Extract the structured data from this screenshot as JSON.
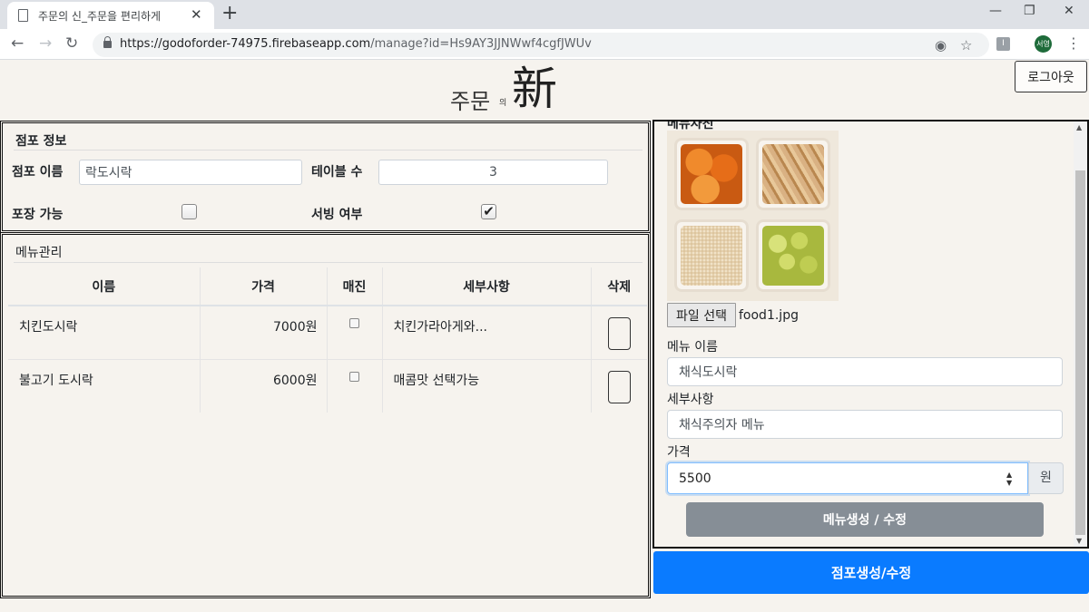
{
  "browser": {
    "tab_title": "주문의 신_주문을 편리하게",
    "url_host": "https://godoforder-74975.firebaseapp.com",
    "url_path": "/manage?id=Hs9AY3JJNWwf4cgfJWUv",
    "profile_initials": "서영"
  },
  "header": {
    "logo_small": "주문",
    "logo_tiny": "의",
    "logo_big": "新",
    "logout_label": "로그아웃"
  },
  "store_info": {
    "title": "점포 정보",
    "name_label": "점포 이름",
    "name_value": "락도시락",
    "tables_label": "테이블 수",
    "tables_value": "3",
    "takeout_label": "포장 가능",
    "takeout_checked": false,
    "serving_label": "서빙 여부",
    "serving_checked": true
  },
  "menu_manage": {
    "title": "메뉴관리",
    "columns": [
      "이름",
      "가격",
      "매진",
      "세부사항",
      "삭제"
    ],
    "rows": [
      {
        "name": "치킨도시락",
        "price": "7000원",
        "sold_out": false,
        "detail": "치킨가라아게와..."
      },
      {
        "name": "불고기 도시락",
        "price": "6000원",
        "sold_out": false,
        "detail": "매콤맛 선택가능"
      }
    ]
  },
  "menu_form": {
    "image_label": "메뉴사진",
    "file_button": "파일 선택",
    "file_name": "food1.jpg",
    "name_label": "메뉴 이름",
    "name_value": "채식도시락",
    "detail_label": "세부사항",
    "detail_value": "채식주의자 메뉴",
    "price_label": "가격",
    "price_value": "5500",
    "price_unit": "원",
    "submit_label": "메뉴생성 / 수정"
  },
  "store_submit_label": "점포생성/수정",
  "colors": {
    "primary": "#0a7bff",
    "secondary": "#868e96",
    "background": "#f6f3ee"
  }
}
